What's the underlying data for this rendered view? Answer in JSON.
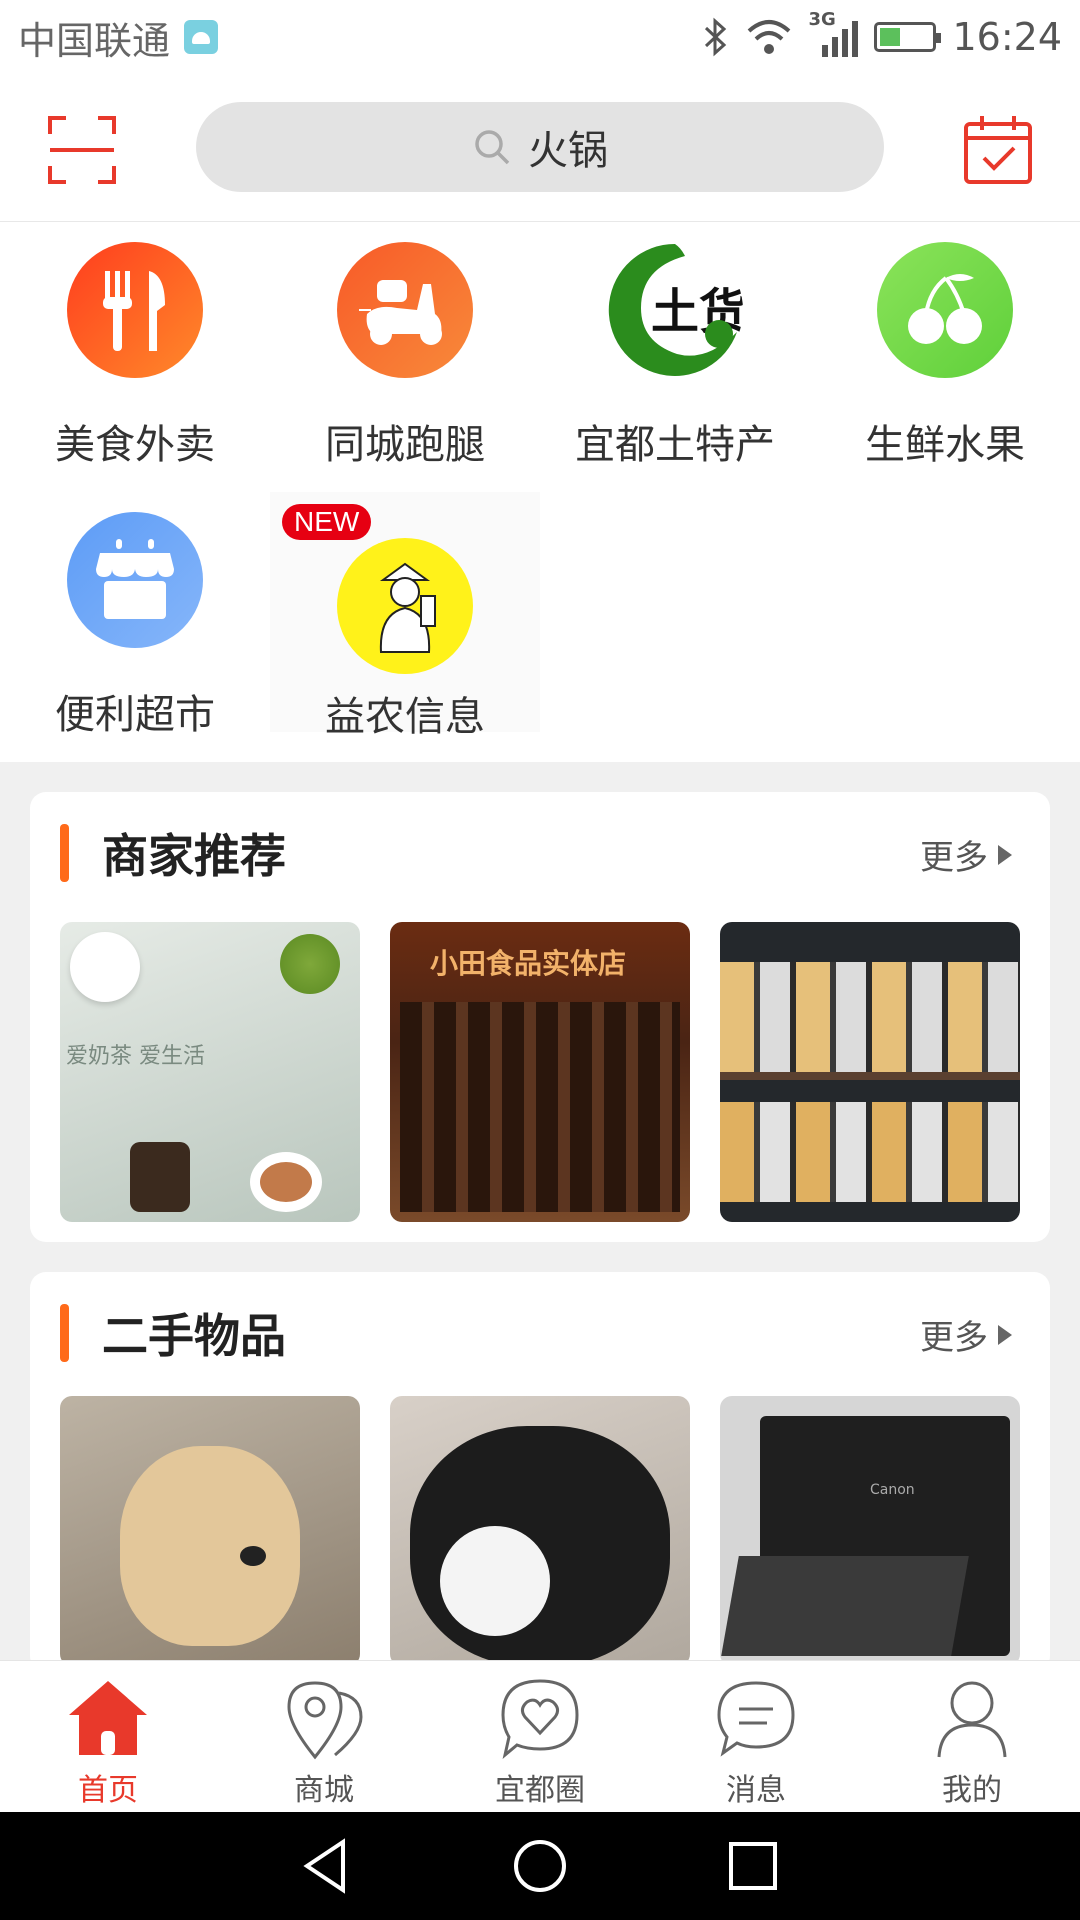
{
  "status_bar": {
    "carrier": "中国联通",
    "network": "3G",
    "time": "16:24"
  },
  "header": {
    "scan_icon": "scan-icon",
    "calendar_icon": "calendar-check-icon",
    "search": {
      "value": "火锅",
      "icon": "search-icon"
    }
  },
  "categories": [
    {
      "label": "美食外卖",
      "icon": "fork-knife-icon",
      "color": "#ff5a1e"
    },
    {
      "label": "同城跑腿",
      "icon": "scooter-icon",
      "color": "#f76b2d"
    },
    {
      "label": "宜都土特产",
      "icon": "native-goods-logo",
      "logo_text": "土货",
      "color": "#2e8b1e"
    },
    {
      "label": "生鲜水果",
      "icon": "cherry-icon",
      "color": "#77d94a"
    },
    {
      "label": "便利超市",
      "icon": "store-icon",
      "color": "#6ea6f5"
    },
    {
      "label": "益农信息",
      "icon": "farmer-icon",
      "badge": "NEW",
      "color": "#fff21a"
    }
  ],
  "merchants": {
    "title": "商家推荐",
    "more": "更多",
    "items": [
      {
        "caption": "爱奶茶 爱生活",
        "kind": "milk-tea-photo"
      },
      {
        "caption": "小田食品实体店",
        "kind": "cured-meat-photo"
      },
      {
        "caption": "",
        "kind": "jars-shelf-photo"
      }
    ]
  },
  "secondhand": {
    "title": "二手物品",
    "more": "更多",
    "items": [
      {
        "kind": "golden-puppy-photo"
      },
      {
        "kind": "husky-puppy-photo"
      },
      {
        "kind": "printer-photo",
        "brand": "Canon"
      }
    ]
  },
  "tabbar": [
    {
      "label": "首页",
      "icon": "home-icon",
      "active": true
    },
    {
      "label": "商城",
      "icon": "map-pin-icon",
      "active": false
    },
    {
      "label": "宜都圈",
      "icon": "heart-bubble-icon",
      "active": false
    },
    {
      "label": "消息",
      "icon": "message-icon",
      "active": false
    },
    {
      "label": "我的",
      "icon": "user-icon",
      "active": false
    }
  ],
  "colors": {
    "accent": "#e8392b",
    "section_bar": "#ff6a1a"
  }
}
